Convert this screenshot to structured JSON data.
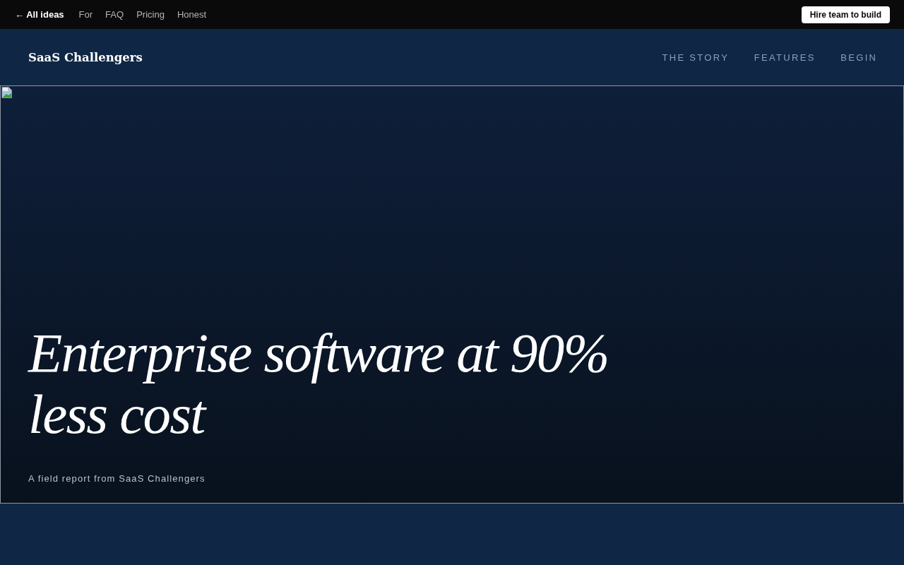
{
  "top_bar": {
    "back_link": "← All ideas",
    "links": [
      "For",
      "FAQ",
      "Pricing",
      "Honest"
    ],
    "cta_button": "Hire team to build"
  },
  "site_header": {
    "brand": "SaaS Challengers",
    "nav": [
      "THE STORY",
      "FEATURES",
      "BEGIN"
    ]
  },
  "hero": {
    "headline": "Enterprise software at 90% less cost",
    "subtitle": "A field report from SaaS Challengers"
  }
}
